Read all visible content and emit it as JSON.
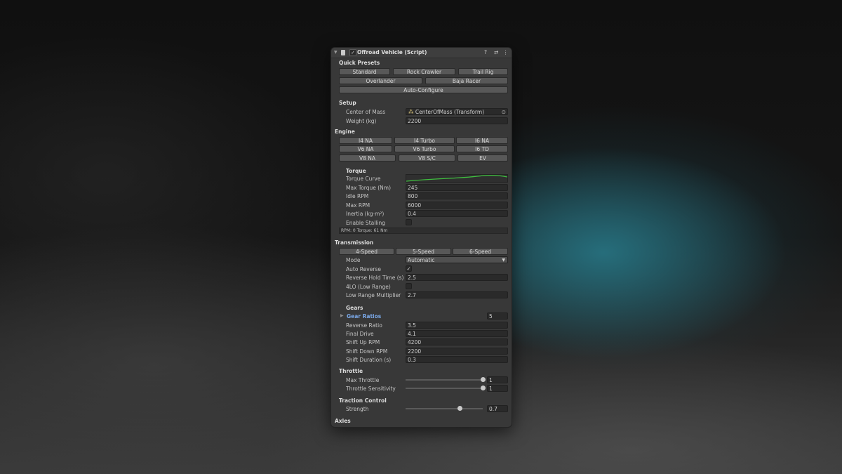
{
  "header": {
    "title": "Offroad Vehicle (Script)",
    "enabled_check": "✓",
    "help_icon": "?",
    "presets_icon": "⇄",
    "menu_icon": "⋮"
  },
  "quick_presets": {
    "title": "Quick Presets",
    "row1": [
      "Standard",
      "Rock Crawler",
      "Trail Rig"
    ],
    "row2": [
      "Overlander",
      "Baja Racer"
    ],
    "auto_configure": "Auto-Configure"
  },
  "setup": {
    "title": "Setup",
    "center_of_mass_label": "Center of Mass",
    "center_of_mass_value": "CenterOfMass (Transform)",
    "weight_label": "Weight (kg)",
    "weight_value": "2200"
  },
  "engine": {
    "title": "Engine",
    "row1": [
      "I4 NA",
      "I4 Turbo",
      "I6 NA"
    ],
    "row2": [
      "V6 NA",
      "V6 Turbo",
      "I6 TD"
    ],
    "row3": [
      "V8 NA",
      "V8 S/C",
      "EV"
    ]
  },
  "torque": {
    "title": "Torque",
    "curve_label": "Torque Curve",
    "max_torque_label": "Max Torque (Nm)",
    "max_torque_value": "245",
    "idle_rpm_label": "Idle RPM",
    "idle_rpm_value": "800",
    "max_rpm_label": "Max RPM",
    "max_rpm_value": "6000",
    "inertia_label": "Inertia (kg·m²)",
    "inertia_value": "0.4",
    "stalling_label": "Enable Stalling",
    "info": "RPM: 0  Torque: 61 Nm",
    "curve_color": "#3fbf3f"
  },
  "transmission": {
    "title": "Transmission",
    "speed_buttons": [
      "4-Speed",
      "5-Speed",
      "6-Speed"
    ],
    "mode_label": "Mode",
    "mode_value": "Automatic",
    "auto_reverse_label": "Auto Reverse",
    "auto_reverse_check": "✓",
    "reverse_hold_label": "Reverse Hold Time (s)",
    "reverse_hold_value": "2.5",
    "low_range_label": "4LO (Low Range)",
    "low_range_mult_label": "Low Range Multiplier",
    "low_range_mult_value": "2.7"
  },
  "gears": {
    "title": "Gears",
    "gear_ratios_label": "Gear Ratios",
    "gear_ratios_count": "5",
    "reverse_ratio_label": "Reverse Ratio",
    "reverse_ratio_value": "3.5",
    "final_drive_label": "Final Drive",
    "final_drive_value": "4.1",
    "shift_up_label": "Shift Up RPM",
    "shift_up_value": "4200",
    "shift_down_label": "Shift Down RPM",
    "shift_down_value": "2200",
    "shift_duration_label": "Shift Duration (s)",
    "shift_duration_value": "0.3"
  },
  "throttle": {
    "title": "Throttle",
    "max_throttle_label": "Max Throttle",
    "max_throttle_value": "1",
    "max_throttle_fraction": 1.0,
    "sensitivity_label": "Throttle Sensitivity",
    "sensitivity_value": "1",
    "sensitivity_fraction": 1.0
  },
  "traction": {
    "title": "Traction Control",
    "strength_label": "Strength",
    "strength_value": "0.7",
    "strength_fraction": 0.7
  },
  "axles": {
    "title": "Axles"
  }
}
